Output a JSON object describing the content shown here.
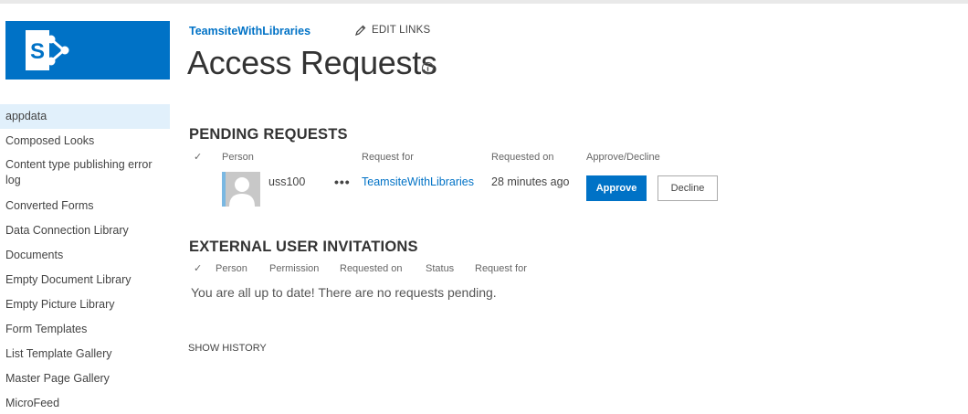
{
  "nav": {
    "items": [
      "appdata",
      "Composed Looks",
      "Content type publishing error log",
      "Converted Forms",
      "Data Connection Library",
      "Documents",
      "Empty Document Library",
      "Empty Picture Library",
      "Form Templates",
      "List Template Gallery",
      "Master Page Gallery",
      "MicroFeed"
    ],
    "selected_index": 0
  },
  "header": {
    "site_name": "TeamsiteWithLibraries",
    "edit_links": "EDIT LINKS",
    "page_title": "Access Requests"
  },
  "pending": {
    "title": "PENDING REQUESTS",
    "columns": {
      "person": "Person",
      "request_for": "Request for",
      "requested_on": "Requested on",
      "approve_decline": "Approve/Decline"
    },
    "row": {
      "person": "uss100",
      "ellipsis": "•••",
      "request_for": "TeamsiteWithLibraries",
      "requested_on": "28 minutes ago",
      "approve": "Approve",
      "decline": "Decline"
    }
  },
  "external": {
    "title": "EXTERNAL USER INVITATIONS",
    "columns": {
      "person": "Person",
      "permission": "Permission",
      "requested_on": "Requested on",
      "status": "Status",
      "request_for": "Request for"
    },
    "empty_message": "You are all up to date! There are no requests pending."
  },
  "show_history": "SHOW HISTORY",
  "colors": {
    "brand": "#0072c6",
    "selected_nav": "#e1f0fb"
  }
}
